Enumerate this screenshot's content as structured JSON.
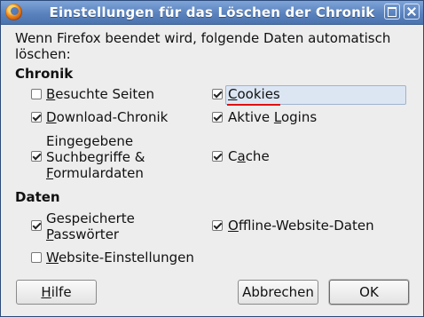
{
  "window": {
    "title": "Einstellungen für das Löschen der Chronik"
  },
  "intro": {
    "line1": "Wenn Firefox beendet wird, folgende Daten automatisch",
    "line2": "löschen:"
  },
  "sections": {
    "chronik": "Chronik",
    "daten": "Daten"
  },
  "checkboxes": {
    "besuchte_seiten": {
      "pre": "",
      "u": "B",
      "post": "esuchte Seiten",
      "checked": false
    },
    "cookies": {
      "pre": "",
      "u": "C",
      "post": "ookies",
      "checked": true
    },
    "download_chronik": {
      "pre": "",
      "u": "D",
      "post": "ownload-Chronik",
      "checked": true
    },
    "aktive_logins": {
      "pre": "Aktive ",
      "u": "L",
      "post": "ogins",
      "checked": true
    },
    "suchbegriffe": {
      "line1": "Eingegebene",
      "line2": "Suchbegriffe &",
      "line3_u": "F",
      "line3_post": "ormulardaten",
      "checked": true
    },
    "cache": {
      "pre": "C",
      "u": "a",
      "post": "che",
      "checked": true
    },
    "passwoerter": {
      "line1": "Gespeicherte",
      "line2_u": "P",
      "line2_post": "asswörter",
      "checked": true
    },
    "offline_daten": {
      "pre": "",
      "u": "O",
      "post": "ffline-Website-Daten",
      "checked": true
    },
    "website_einstellungen": {
      "pre": "",
      "u": "W",
      "post": "ebsite-Einstellungen",
      "checked": false
    }
  },
  "buttons": {
    "help_u": "H",
    "help_post": "ilfe",
    "cancel": "Abbrechen",
    "ok": "OK"
  }
}
